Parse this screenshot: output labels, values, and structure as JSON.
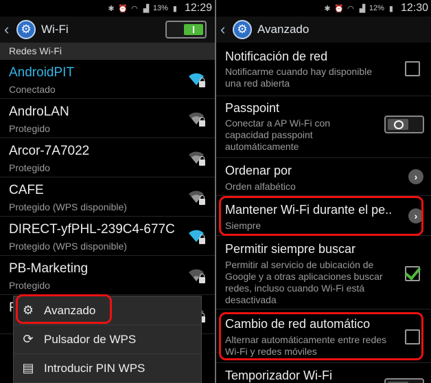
{
  "left": {
    "status": {
      "battery": "13%",
      "time": "12:29"
    },
    "title": "Wi-Fi",
    "section": "Redes Wi-Fi",
    "networks": [
      {
        "name": "AndroidPIT",
        "status": "Conectado",
        "connected": true
      },
      {
        "name": "AndroLAN",
        "status": "Protegido",
        "connected": false
      },
      {
        "name": "Arcor-7A7022",
        "status": "Protegido",
        "connected": false
      },
      {
        "name": "CAFE",
        "status": "Protegido (WPS disponible)",
        "connected": false
      },
      {
        "name": "DIRECT-yfPHL-239C4-677C",
        "status": "Protegido (WPS disponible)",
        "connected": false
      },
      {
        "name": "PB-Marketing",
        "status": "Protegido",
        "connected": false
      },
      {
        "name": "F",
        "status": "",
        "connected": false
      }
    ],
    "menu": [
      {
        "label": "Avanzado",
        "icon": "gear-icon"
      },
      {
        "label": "Pulsador de WPS",
        "icon": "wps-icon"
      },
      {
        "label": "Introducir PIN WPS",
        "icon": "wps-pin-icon"
      }
    ]
  },
  "right": {
    "status": {
      "battery": "12%",
      "time": "12:30"
    },
    "title": "Avanzado",
    "settings": [
      {
        "title": "Notificación de red",
        "sub": "Notificarme cuando hay disponible una red abierta"
      },
      {
        "title": "Passpoint",
        "sub": "Conectar a AP Wi-Fi con capacidad passpoint automáticamente"
      },
      {
        "title": "Ordenar por",
        "sub": "Orden alfabético"
      },
      {
        "title": "Mantener Wi-Fi durante el pe..",
        "sub": "Siempre"
      },
      {
        "title": "Permitir siempre buscar",
        "sub": "Permitir al servicio de ubicación de Google y a otras aplicaciones buscar redes, incluso cuando Wi-Fi está desactivada"
      },
      {
        "title": "Cambio de red automático",
        "sub": "Alternar automáticamente entre redes Wi-Fi y redes móviles"
      },
      {
        "title": "Temporizador Wi-Fi",
        "sub": ""
      }
    ]
  },
  "colors": {
    "accent": "#33b5e5",
    "highlight": "#e11111",
    "toggle_on": "#4fb83a"
  }
}
